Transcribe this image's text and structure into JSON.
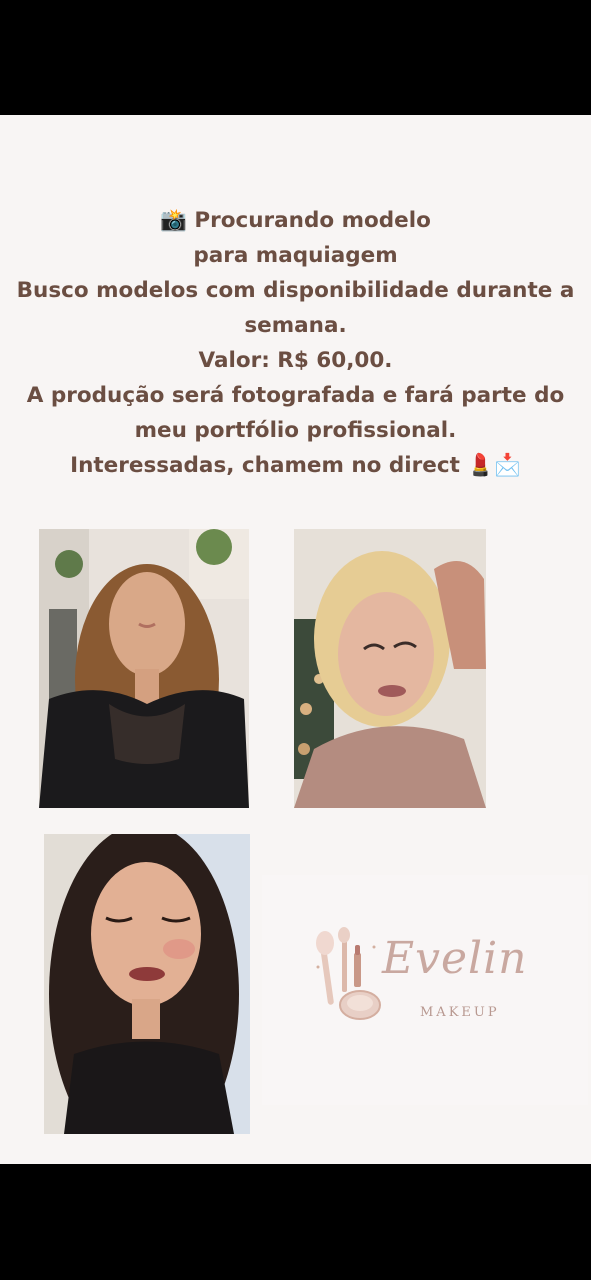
{
  "post": {
    "lines": [
      {
        "emoji": "📸",
        "text": "Procurando modelo"
      },
      {
        "text": "para maquiagem"
      },
      {
        "text": "Busco modelos com disponibilidade durante a"
      },
      {
        "text": "semana."
      },
      {
        "text": "Valor: R$ 60,00."
      },
      {
        "text": "A produção será fotografada e fará parte do"
      },
      {
        "text": "meu portfólio profissional."
      },
      {
        "text": "Interessadas, chamem no direct",
        "emoji_after": "💄📩"
      }
    ]
  },
  "logo": {
    "name": "Evelin",
    "subtitle": "MAKEUP"
  },
  "colors": {
    "text": "#6b4e42",
    "background": "#f8f5f4",
    "logo": "#c9a8a0"
  }
}
